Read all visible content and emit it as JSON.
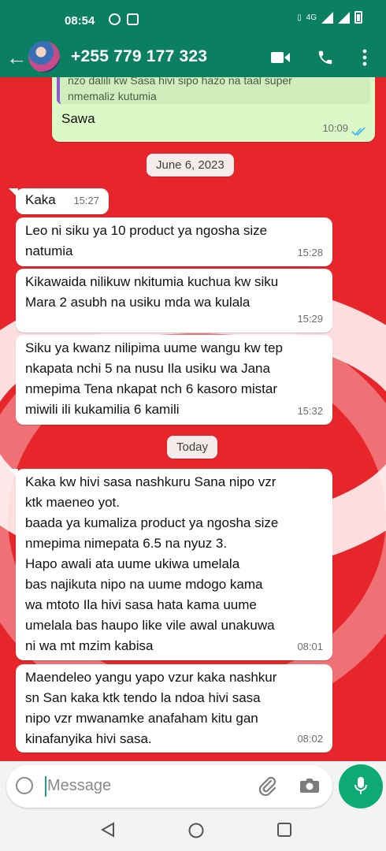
{
  "status_bar": {
    "time": "08:54",
    "network_label": "4G"
  },
  "header": {
    "contact_name": "+255 779 177 323",
    "icons": [
      "back-arrow-icon",
      "video-call-icon",
      "phone-call-icon",
      "more-vert-icon"
    ]
  },
  "chat": {
    "quoted_reply": {
      "quote_text": "nzo dalili kw Sasa hivi sipo hazo na taal super\nnmemaliz kutumia",
      "text": "Sawa",
      "time": "10:09"
    },
    "date_chip_1": "June 6, 2023",
    "date_chip_2": "Today",
    "messages": [
      {
        "text": "Kaka",
        "time": "15:27"
      },
      {
        "text": "Leo ni siku ya 10 product ya ngosha size\nnatumia",
        "time": "15:28"
      },
      {
        "text": "Kikawaida nilikuw nkitumia kuchua kw siku\nMara 2 asubh na usiku mda wa kulala",
        "time": "15:29"
      },
      {
        "text": "Siku ya kwanz nilipima uume wangu kw tep\nnkapata nchi 5 na nusu Ila usiku wa Jana\nnmepima Tena nkapat nch 6 kasoro mistar\nmiwili ili kukamilia 6 kamili",
        "time": "15:32"
      },
      {
        "text": "Kaka kw hivi sasa nashkuru Sana nipo vzr\nktk maeneo yot.\nbaada ya kumaliza product ya ngosha size\nnmepima nimepata 6.5 na nyuz 3.\nHapo awali ata uume ukiwa umelala\nbas najikuta nipo na uume mdogo kama\nwa mtoto Ila hivi sasa hata kama uume\numelala bas haupo like vile awal unakuwa\nni wa mt mzim kabisa",
        "time": "08:01"
      },
      {
        "text": "Maendeleo yangu yapo vzur kaka nashkur\nsn San kaka ktk tendo la ndoa hivi sasa\nnipo vzr mwanamke anafaham kitu gan\nkinafanyika hivi sasa.",
        "time": "08:02"
      }
    ]
  },
  "composer": {
    "placeholder": "Message"
  },
  "colors": {
    "header_green": "#0b7f62",
    "wallpaper_red": "#e6262b",
    "outgoing_bubble": "#dcf8c6",
    "incoming_bubble": "#ffffff",
    "mic_button": "#0eaa74",
    "read_ticks": "#34b7f1"
  }
}
